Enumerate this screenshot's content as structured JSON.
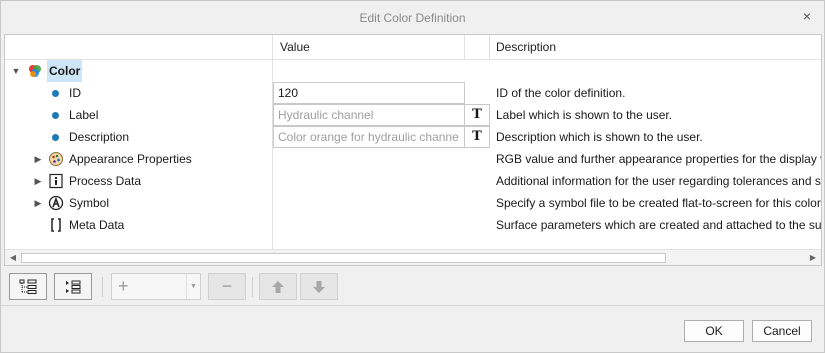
{
  "dialog": {
    "title": "Edit Color Definition",
    "close_glyph": "×",
    "ok_label": "OK",
    "cancel_label": "Cancel"
  },
  "grid": {
    "columns": [
      "",
      "Value",
      "",
      "Description"
    ],
    "root": {
      "label": "Color",
      "icon": "color-palette-icon",
      "expanded": true
    },
    "rows": [
      {
        "label": "ID",
        "value": "120",
        "value_is_placeholder": false,
        "has_text_button": false,
        "description": "ID of the color definition."
      },
      {
        "label": "Label",
        "value": "Hydraulic channel",
        "value_is_placeholder": true,
        "has_text_button": true,
        "description": "Label which is shown to the user."
      },
      {
        "label": "Description",
        "value": "Color orange for hydraulic channe",
        "value_is_placeholder": true,
        "has_text_button": true,
        "description": "Description which is shown to the user."
      },
      {
        "label": "Appearance Properties",
        "icon": "appearance-icon",
        "expandable": true,
        "description": "RGB value and further appearance properties for the display w"
      },
      {
        "label": "Process Data",
        "icon": "info-icon",
        "expandable": true,
        "description": "Additional information for the user regarding tolerances and s"
      },
      {
        "label": "Symbol",
        "icon": "symbol-icon",
        "expandable": true,
        "description": "Specify a symbol file to be created flat-to-screen for this color"
      },
      {
        "label": "Meta Data",
        "icon": "braces-icon",
        "expandable": false,
        "description": "Surface parameters which are created and attached to the surf"
      }
    ],
    "text_button_glyph": "T"
  },
  "toolbar": {
    "expand_all": "expand-all-icon",
    "collapse_all": "collapse-all-icon",
    "add_glyph": "+",
    "remove_glyph": "−",
    "move_up": "arrow-up-icon",
    "move_down": "arrow-down-icon"
  }
}
